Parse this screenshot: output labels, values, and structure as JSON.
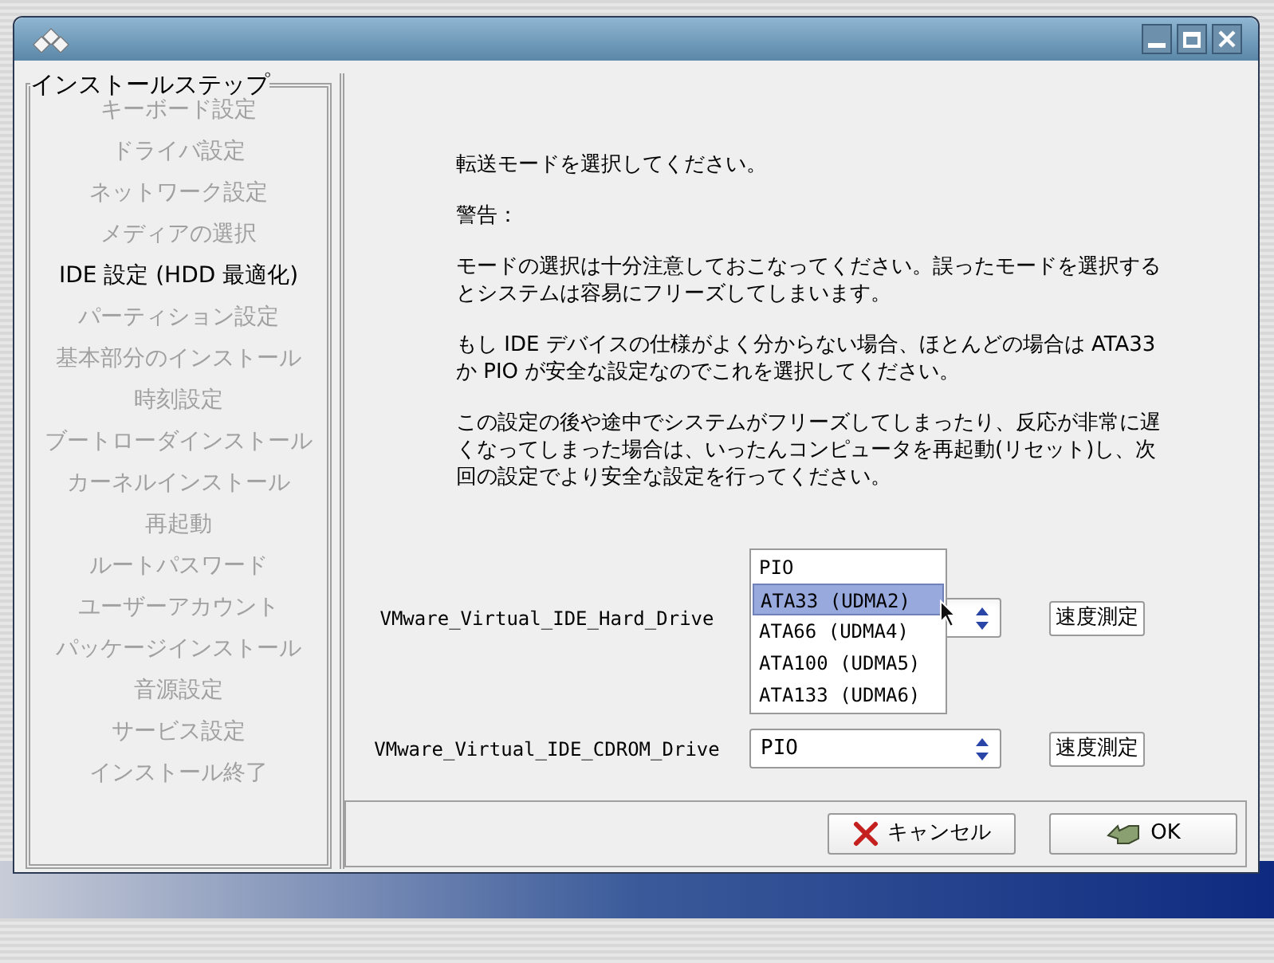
{
  "steps_panel": {
    "title": "インストールステップ",
    "steps": [
      {
        "label": "キーボード設定",
        "selected": false
      },
      {
        "label": "ドライバ設定",
        "selected": false
      },
      {
        "label": "ネットワーク設定",
        "selected": false
      },
      {
        "label": "メディアの選択",
        "selected": false
      },
      {
        "label": "IDE 設定 (HDD 最適化)",
        "selected": true
      },
      {
        "label": "パーティション設定",
        "selected": false
      },
      {
        "label": "基本部分のインストール",
        "selected": false
      },
      {
        "label": "時刻設定",
        "selected": false
      },
      {
        "label": "ブートローダインストール",
        "selected": false
      },
      {
        "label": "カーネルインストール",
        "selected": false
      },
      {
        "label": "再起動",
        "selected": false
      },
      {
        "label": "ルートパスワード",
        "selected": false
      },
      {
        "label": "ユーザーアカウント",
        "selected": false
      },
      {
        "label": "パッケージインストール",
        "selected": false
      },
      {
        "label": "音源設定",
        "selected": false
      },
      {
        "label": "サービス設定",
        "selected": false
      },
      {
        "label": "インストール終了",
        "selected": false
      }
    ]
  },
  "message": [
    "転送モードを選択してください。",
    "警告：",
    "モードの選択は十分注意しておこなってください。誤ったモードを選択するとシステムは容易にフリーズしてしまいます。",
    "もし IDE デバイスの仕様がよく分からない場合、ほとんどの場合は ATA33 か PIO が安全な設定なのでこれを選択してください。",
    "この設定の後や途中でシステムがフリーズしてしまったり、反応が非常に遅くなってしまった場合は、いったんコンピュータを再起動(リセット)し、次回の設定でより安全な設定を行ってください。"
  ],
  "drives": [
    {
      "name": "VMware_Virtual_IDE_Hard_Drive",
      "expanded": true,
      "options": [
        {
          "label": "PIO",
          "selected": false
        },
        {
          "label": "ATA33 (UDMA2)",
          "selected": true
        },
        {
          "label": "ATA66 (UDMA4)",
          "selected": false
        },
        {
          "label": "ATA100 (UDMA5)",
          "selected": false
        },
        {
          "label": "ATA133 (UDMA6)",
          "selected": false
        }
      ],
      "button": "速度測定"
    },
    {
      "name": "VMware_Virtual_IDE_CDROM_Drive",
      "expanded": false,
      "value": "PIO",
      "button": "速度測定"
    }
  ],
  "buttons": [
    {
      "kind": "cancel",
      "label": "キャンセル"
    },
    {
      "kind": "ok",
      "label": "OK"
    }
  ]
}
